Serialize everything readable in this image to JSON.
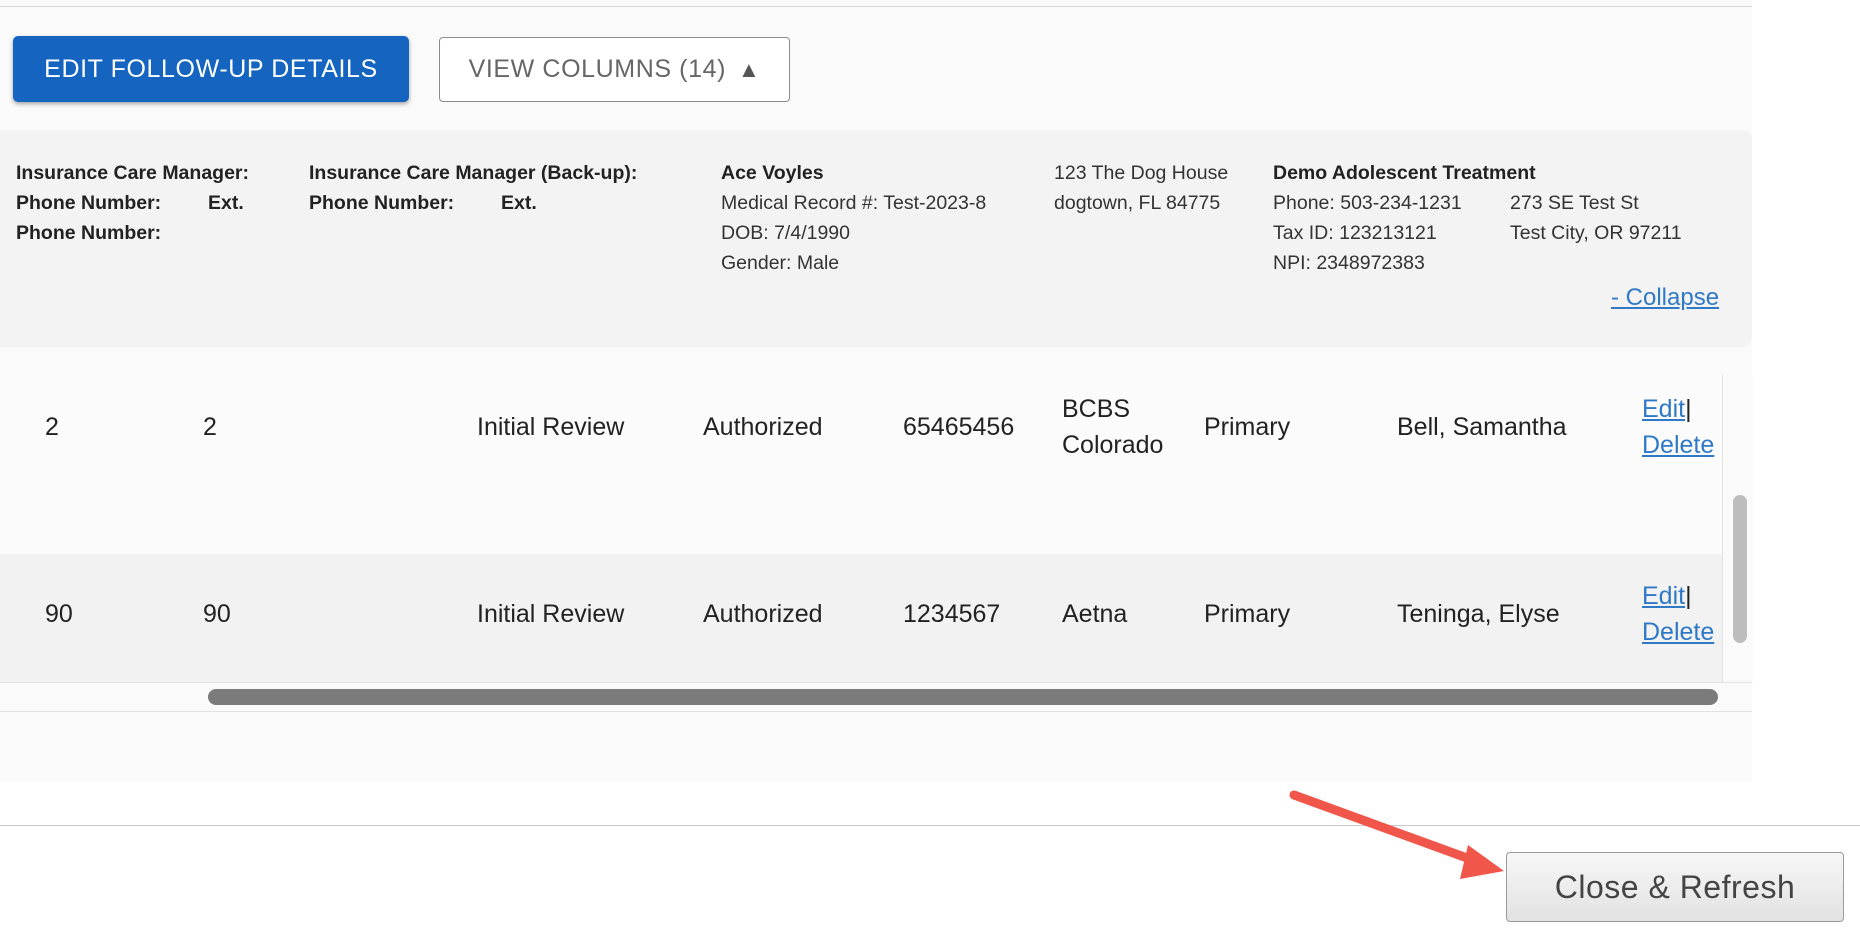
{
  "toolbar": {
    "edit_followup_label": "EDIT FOLLOW-UP DETAILS",
    "view_columns_label": "VIEW COLUMNS (14)",
    "view_columns_icon": "triangle-up-icon"
  },
  "info": {
    "icm_label": "Insurance Care Manager:",
    "icm_phone_label": "Phone Number:",
    "icm_ext_label": "Ext.",
    "icm_phone2_label": "Phone Number:",
    "icm_backup_label": "Insurance Care Manager (Back-up):",
    "icm_backup_phone_label": "Phone Number:",
    "icm_backup_ext_label": "Ext.",
    "patient_name": "Ace Voyles",
    "patient_mrn": "Medical Record #: Test-2023-8",
    "patient_dob": "DOB: 7/4/1990",
    "patient_gender": "Gender: Male",
    "patient_address1": "123 The Dog House",
    "patient_address2": "dogtown, FL 84775",
    "facility_name": "Demo Adolescent Treatment",
    "facility_phone": "Phone: 503-234-1231",
    "facility_taxid": "Tax ID: 123213121",
    "facility_npi": "NPI: 2348972383",
    "facility_address1": "273 SE Test St",
    "facility_address2": "Test City, OR 97211",
    "collapse_label": "- Collapse"
  },
  "table": {
    "rows": [
      {
        "col1": "2",
        "col2": "2",
        "review": "Initial Review",
        "status": "Authorized",
        "auth_number": "65465456",
        "payer_line1": "BCBS",
        "payer_line2": "Colorado",
        "priority": "Primary",
        "care_manager": "Bell, Samantha",
        "edit_label": "Edit",
        "separator": "|",
        "delete_label": "Delete"
      },
      {
        "col1": "90",
        "col2": "90",
        "review": "Initial Review",
        "status": "Authorized",
        "auth_number": "1234567",
        "payer_line1": "Aetna",
        "payer_line2": "",
        "priority": "Primary",
        "care_manager": "Teninga, Elyse",
        "edit_label": "Edit",
        "separator": "|",
        "delete_label": "Delete"
      }
    ]
  },
  "footer": {
    "close_refresh_label": "Close & Refresh"
  },
  "colors": {
    "primary": "#1565c0",
    "link": "#2f79c6",
    "annotation_arrow": "#f0564a"
  }
}
